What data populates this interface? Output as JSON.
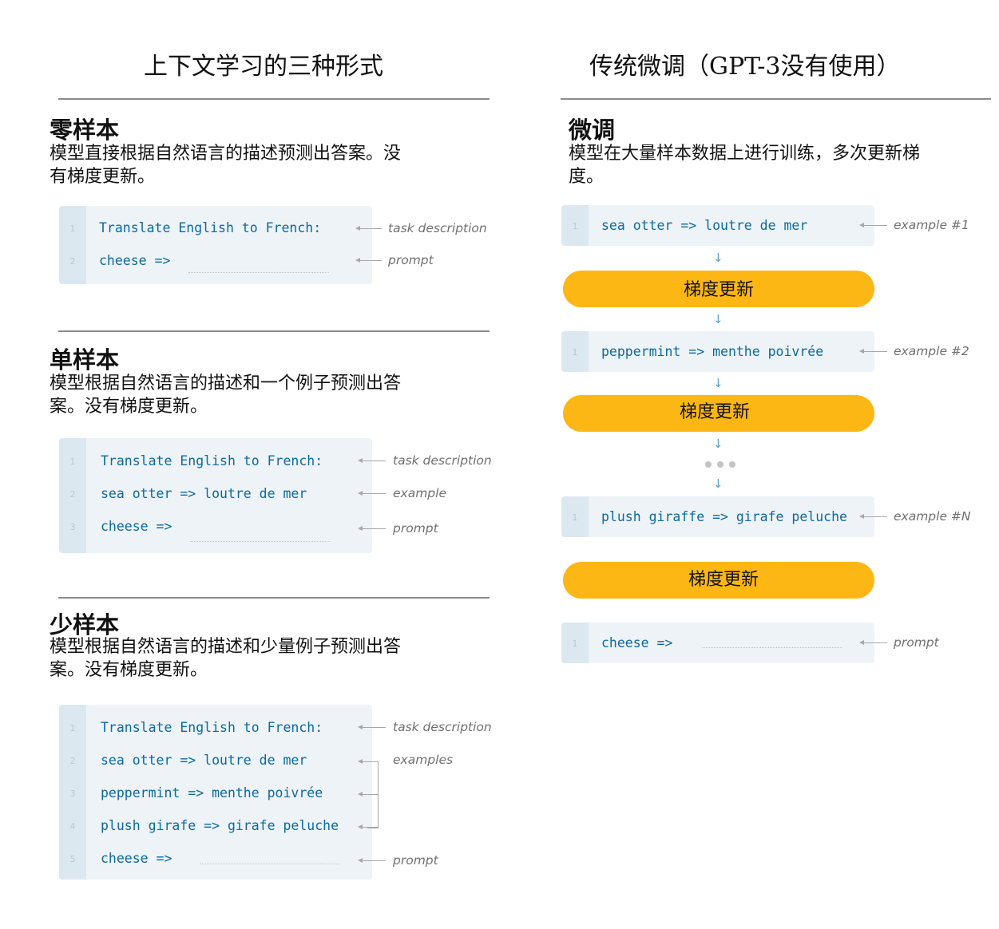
{
  "left": {
    "title": "上下文学习的三种形式",
    "zero_shot": {
      "title": "零样本",
      "desc_lines": [
        "模型直接根据自然语言的描述预测出答案。没",
        "有梯度更新。"
      ],
      "lines": [
        {
          "n": "1",
          "text": "Translate English to French:"
        },
        {
          "n": "2",
          "text": "cheese =>"
        }
      ],
      "labels": [
        "task description",
        "prompt"
      ]
    },
    "one_shot": {
      "title": "单样本",
      "desc_lines": [
        "模型根据自然语言的描述和一个例子预测出答",
        "案。没有梯度更新。"
      ],
      "lines": [
        {
          "n": "1",
          "text": "Translate English to French:"
        },
        {
          "n": "2",
          "text": "sea otter => loutre de mer"
        },
        {
          "n": "3",
          "text": "cheese =>"
        }
      ],
      "labels": [
        "task description",
        "example",
        "prompt"
      ]
    },
    "few_shot": {
      "title": "少样本",
      "desc_lines": [
        "模型根据自然语言的描述和少量例子预测出答",
        "案。没有梯度更新。"
      ],
      "lines": [
        {
          "n": "1",
          "text": "Translate English to French:"
        },
        {
          "n": "2",
          "text": "sea otter => loutre de mer"
        },
        {
          "n": "3",
          "text": "peppermint => menthe poivrée"
        },
        {
          "n": "4",
          "text": "plush girafe => girafe peluche"
        },
        {
          "n": "5",
          "text": "cheese =>"
        }
      ],
      "labels": [
        "task description",
        "examples",
        "prompt"
      ]
    }
  },
  "right": {
    "title": "传统微调（GPT-3没有使用）",
    "fine_tune": {
      "title": "微调",
      "desc_lines": [
        "模型在大量样本数据上进行训练，多次更新梯",
        "度。"
      ]
    },
    "steps": [
      {
        "n": "1",
        "text": "sea otter => loutre de mer",
        "label": "example #1"
      },
      {
        "n": "1",
        "text": "peppermint => menthe poivrée",
        "label": "example #2"
      },
      {
        "n": "1",
        "text": "plush giraffe => girafe peluche",
        "label": "example #N"
      },
      {
        "n": "1",
        "text": "cheese =>",
        "label": "prompt"
      }
    ],
    "update_label": "梯度更新",
    "down_arrow": "↓"
  }
}
